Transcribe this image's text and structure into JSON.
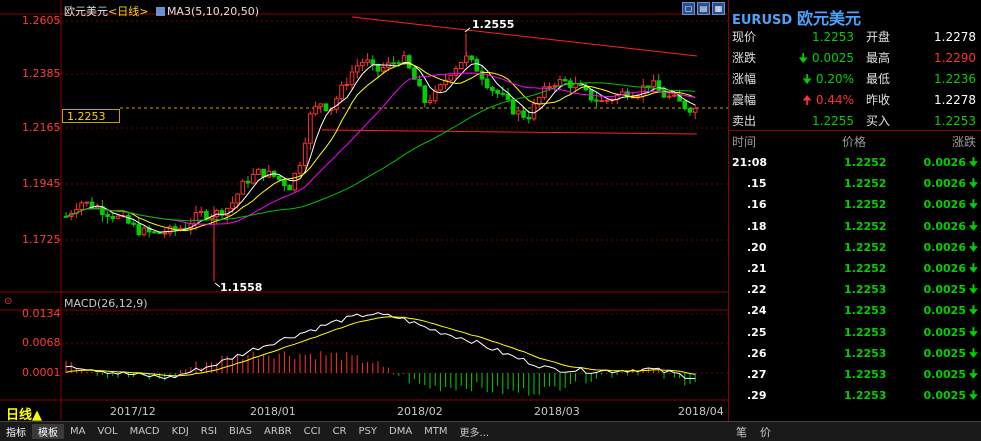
{
  "header": {
    "symbol_cn": "欧元美元",
    "period_tag": "<日线>",
    "ma_label": "MA3(5,10,20,50)"
  },
  "price_axis": [
    "1.2605",
    "1.2385",
    "1.2165",
    "1.1945",
    "1.1725"
  ],
  "current_price_box": "1.2253",
  "annotations": {
    "high": "1.2555",
    "low": "1.1558"
  },
  "macd": {
    "title": "MACD(26,12,9)",
    "axis": [
      "0.0134",
      "0.0068",
      "0.0001"
    ]
  },
  "period_label": "日线▲",
  "dates": [
    "2017/12",
    "2018/01",
    "2018/02",
    "2018/03",
    "2018/04"
  ],
  "bottom_tabs": [
    "指标",
    "模板",
    "MA",
    "VOL",
    "MACD",
    "KDJ",
    "RSI",
    "BIAS",
    "ARBR",
    "CCI",
    "CR",
    "PSY",
    "DMA",
    "MTM",
    "更多..."
  ],
  "bottom_right": {
    "a": "笔",
    "b": "价"
  },
  "quote": {
    "code": "EURUSD",
    "name": "欧元美元",
    "rows": [
      {
        "l1": "现价",
        "v1": "1.2253",
        "l2": "开盘",
        "v2": "1.2278"
      },
      {
        "l1": "涨跌",
        "v1": "0.0025",
        "l2": "最高",
        "v2": "1.2290"
      },
      {
        "l1": "涨幅",
        "v1": "0.20%",
        "l2": "最低",
        "v2": "1.2236"
      },
      {
        "l1": "震幅",
        "v1": "0.44%",
        "l2": "昨收",
        "v2": "1.2278"
      },
      {
        "l1": "卖出",
        "v1": "1.2255",
        "l2": "买入",
        "v2": "1.2253"
      }
    ]
  },
  "trades": {
    "headers": [
      "时间",
      "价格",
      "涨跌"
    ],
    "rows": [
      {
        "t": "21:08",
        "p": "1.2252",
        "c": "0.0026"
      },
      {
        "t": ".15",
        "p": "1.2252",
        "c": "0.0026"
      },
      {
        "t": ".16",
        "p": "1.2252",
        "c": "0.0026"
      },
      {
        "t": ".18",
        "p": "1.2252",
        "c": "0.0026"
      },
      {
        "t": ".20",
        "p": "1.2252",
        "c": "0.0026"
      },
      {
        "t": ".21",
        "p": "1.2252",
        "c": "0.0026"
      },
      {
        "t": ".22",
        "p": "1.2253",
        "c": "0.0025"
      },
      {
        "t": ".24",
        "p": "1.2253",
        "c": "0.0025"
      },
      {
        "t": ".25",
        "p": "1.2253",
        "c": "0.0025"
      },
      {
        "t": ".26",
        "p": "1.2253",
        "c": "0.0025"
      },
      {
        "t": ".27",
        "p": "1.2253",
        "c": "0.0025"
      },
      {
        "t": ".29",
        "p": "1.2253",
        "c": "0.0025"
      }
    ]
  },
  "colors": {
    "up": "#ff3030",
    "down": "#00d000",
    "ma5": "#ffffff",
    "ma10": "#ffff00",
    "ma20": "#ff00ff",
    "ma50": "#00c000",
    "trend": "#ff2020"
  }
}
